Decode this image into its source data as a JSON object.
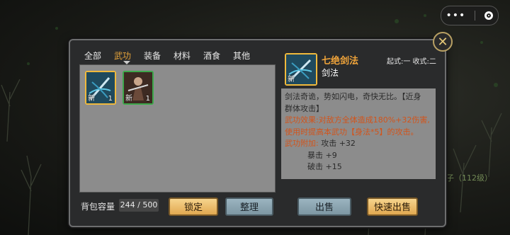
{
  "topbar": {
    "menu_icon": "ellipsis-icon",
    "record_icon": "target-icon"
  },
  "close_icon": "close-x-icon",
  "map_labels": [
    "子（112级）"
  ],
  "tabs": [
    {
      "label": "全部"
    },
    {
      "label": "武功"
    },
    {
      "label": "装备"
    },
    {
      "label": "材料"
    },
    {
      "label": "酒食"
    },
    {
      "label": "其他"
    }
  ],
  "active_tab": "武功",
  "inventory": {
    "items": [
      {
        "badge": "新",
        "count": "1",
        "rarity_color": "#f0b93c",
        "icon": "sword-art-icon"
      },
      {
        "badge": "新",
        "count": "1",
        "rarity_color": "#3da84b",
        "icon": "martial-figure-icon"
      }
    ],
    "capacity_label": "背包容量",
    "capacity_value": "244 / 500"
  },
  "buttons": {
    "lock": "锁定",
    "sort": "整理",
    "sell": "出售",
    "quick_sell": "快速出售"
  },
  "detail": {
    "badge": "新",
    "name": "七绝剑法",
    "type": "剑法",
    "stance": "起式:一  收式:二",
    "desc_lines": [
      "剑法奇诡，势如闪电，奇快无比。【近身",
      "群体攻击】"
    ],
    "effect_lines": [
      "武功效果:对敌方全体造成180%+32伤害,",
      "使用时提高本武功【身法*5】的攻击。"
    ],
    "bonus_title": "武功附加:",
    "bonus": [
      {
        "label": "攻击",
        "value": "+32"
      },
      {
        "label": "暴击",
        "value": "+9"
      },
      {
        "label": "破击",
        "value": "+15"
      }
    ]
  },
  "colors": {
    "rarity_gold": "#f0b93c",
    "rarity_green": "#3da84b",
    "accent": "#f0a43a",
    "effect": "#d2541b"
  }
}
